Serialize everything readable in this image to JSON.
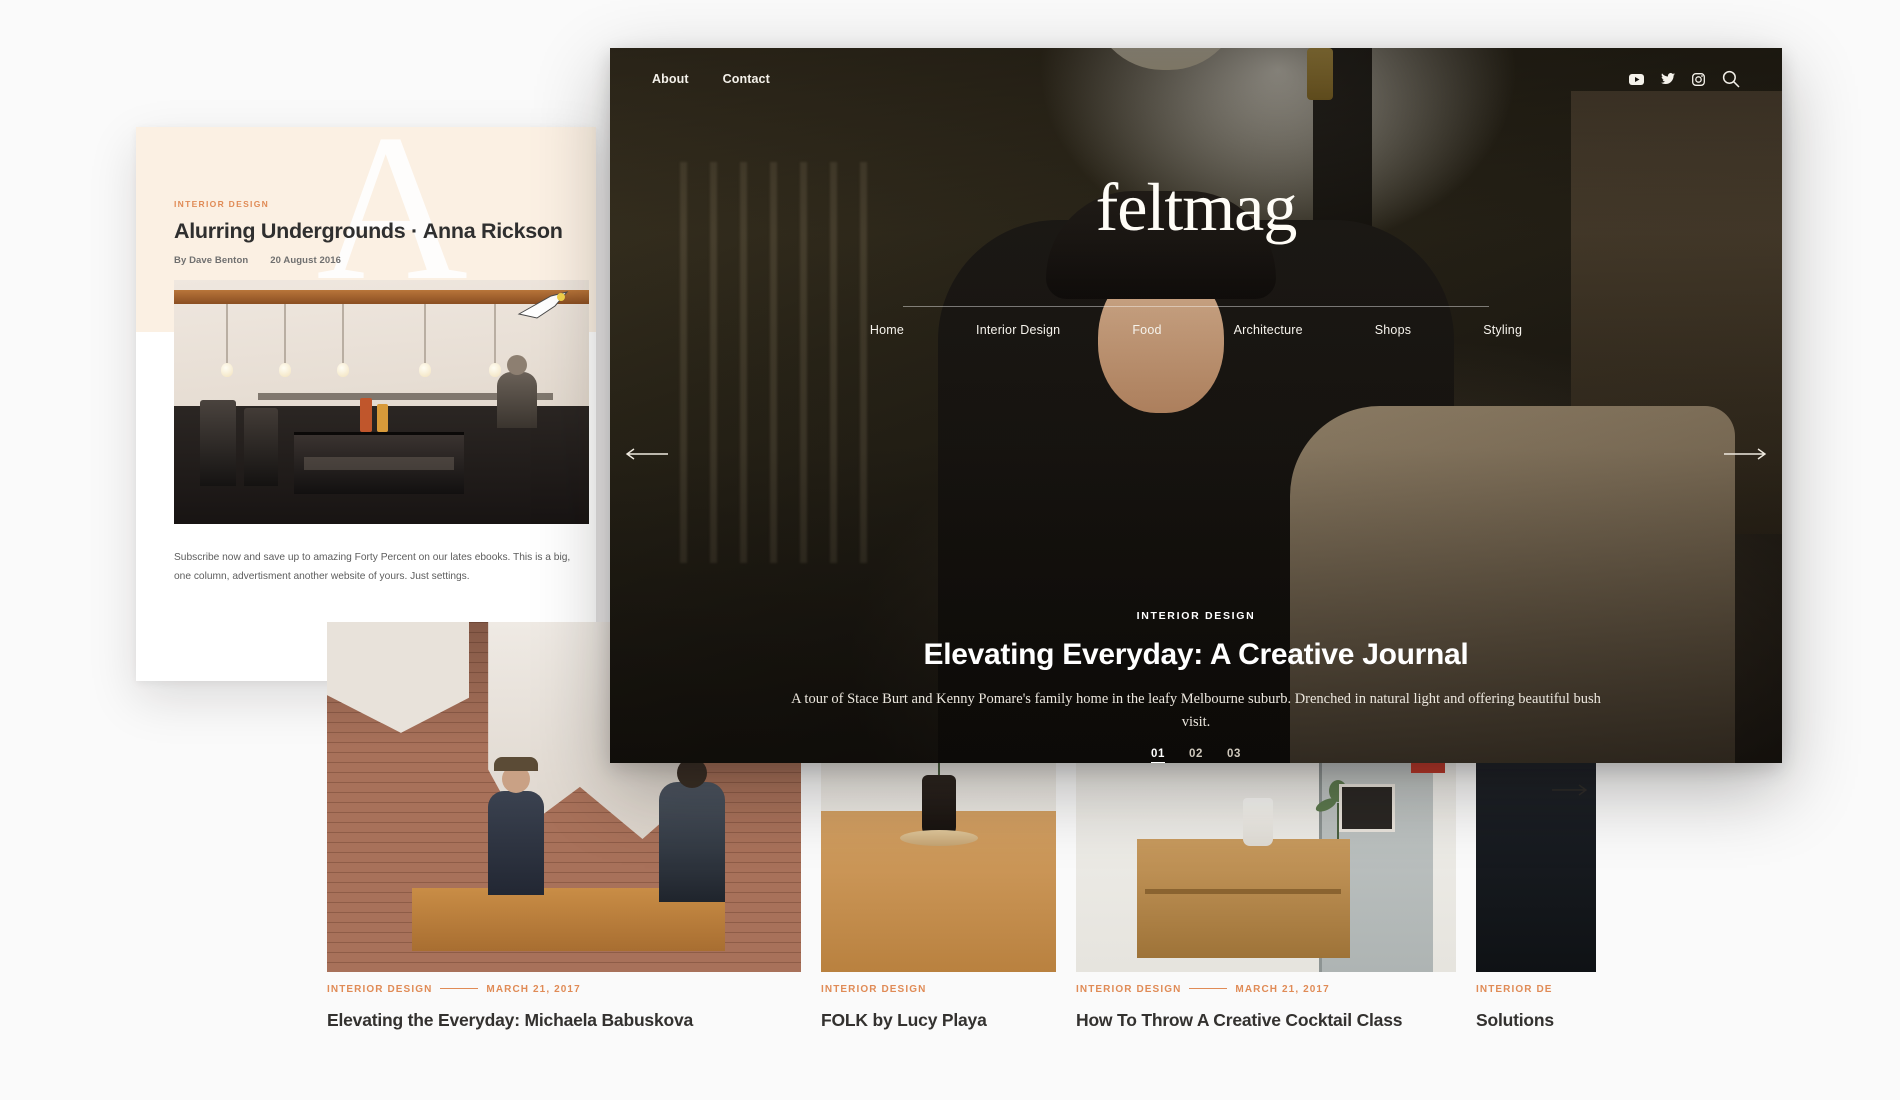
{
  "background_color": "#fafafa",
  "accent_color": "#e08b56",
  "article_card": {
    "kicker": "INTERIOR DESIGN",
    "title": "Alurring Undergrounds · Anna Rickson",
    "author": "By Dave Benton",
    "date": "20 August 2016",
    "watermark_letter": "A",
    "photo_alt": "cafe-interior-espresso-machine-photo",
    "body": "Subscribe now and save up to amazing Forty Percent on our lates ebooks. This is a big, one column, advertisment another website of yours. Just settings."
  },
  "hero": {
    "top_links": [
      {
        "label": "About"
      },
      {
        "label": "Contact"
      }
    ],
    "social_icons": [
      {
        "name": "youtube-icon"
      },
      {
        "name": "twitter-icon"
      },
      {
        "name": "instagram-icon"
      },
      {
        "name": "search-icon"
      }
    ],
    "logo": "feltmag",
    "nav": [
      {
        "label": "Home"
      },
      {
        "label": "Interior Design"
      },
      {
        "label": "Food"
      },
      {
        "label": "Architecture"
      },
      {
        "label": "Shops"
      },
      {
        "label": "Styling"
      }
    ],
    "prev_arrow": "←",
    "next_arrow": "→",
    "slide": {
      "kicker": "INTERIOR DESIGN",
      "title": "Elevating Everyday: A Creative Journal",
      "description": "A tour of Stace Burt and Kenny Pomare's family home in the leafy Melbourne suburb. Drenched in natural light and offering beautiful bush visit."
    },
    "pagination": [
      {
        "label": "01",
        "active": true
      },
      {
        "label": "02",
        "active": false
      },
      {
        "label": "03",
        "active": false
      }
    ],
    "photo_alt": "smiling-woman-in-hat-on-sofa-photo"
  },
  "grid": {
    "next_arrow": "→",
    "cards": [
      {
        "category": "INTERIOR DESIGN",
        "date": "MARCH 21, 2017",
        "has_rule": true,
        "title": "Elevating the Everyday: Michaela Babuskova",
        "photo_alt": "two-men-at-table-brick-wall-cafe-photo"
      },
      {
        "category": "INTERIOR DESIGN",
        "date": "",
        "has_rule": false,
        "title": "FOLK by Lucy Playa",
        "photo_alt": "eucalyptus-plant-in-dark-vase-on-wood-table-photo"
      },
      {
        "category": "INTERIOR DESIGN",
        "date": "MARCH 21, 2017",
        "has_rule": true,
        "title": "How To Throw A Creative Cocktail Class",
        "photo_alt": "cafe-side-table-with-jug-and-chalkboard-photo"
      },
      {
        "category": "INTERIOR DE",
        "date": "",
        "has_rule": false,
        "title": "Solutions",
        "photo_alt": "person-in-dark-shirt-near-barrels-photo"
      }
    ]
  }
}
